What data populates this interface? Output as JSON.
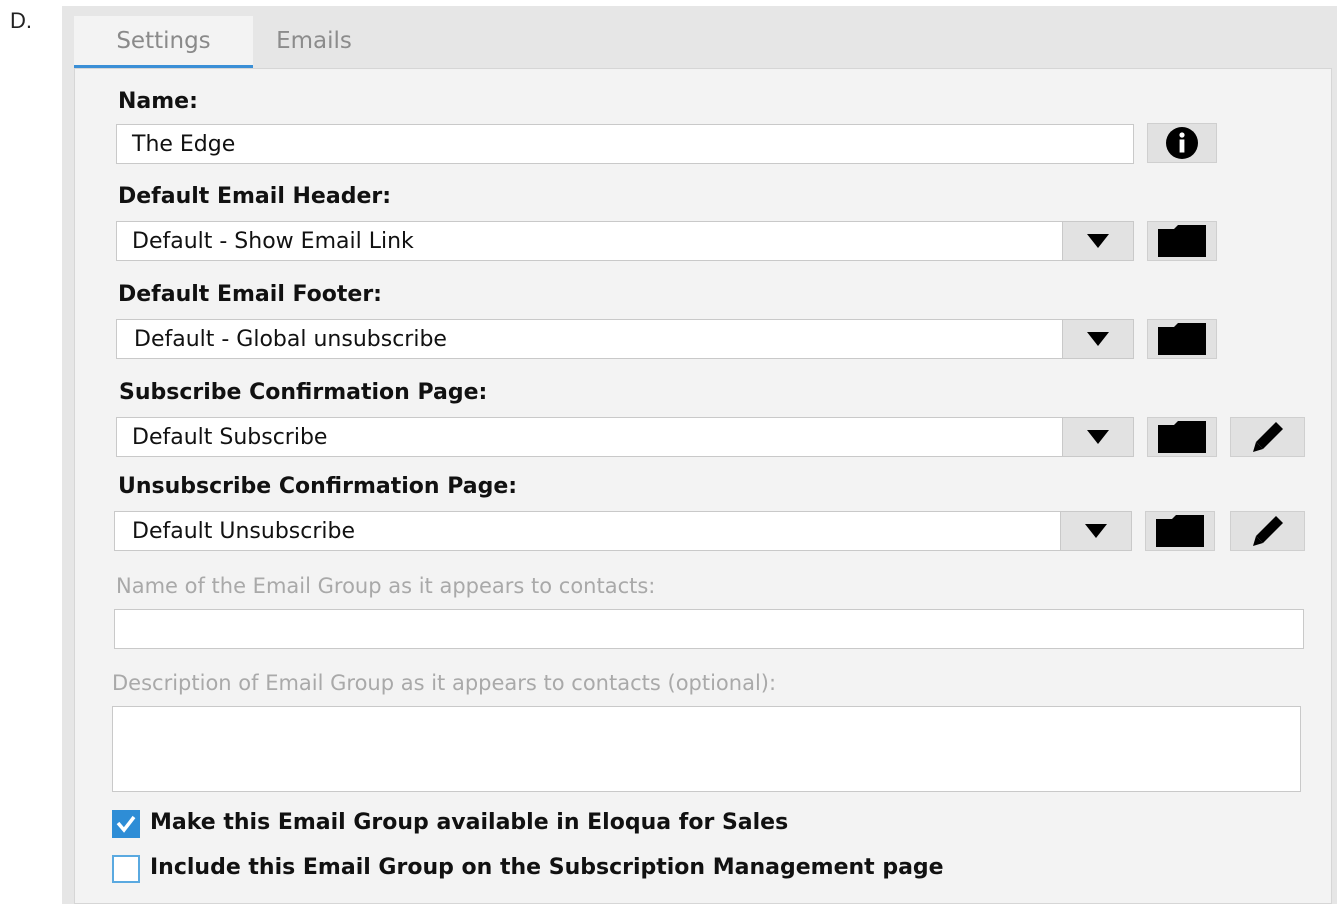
{
  "option_letter": "D.",
  "tabs": [
    {
      "label": "Settings",
      "active": true
    },
    {
      "label": "Emails",
      "active": false
    }
  ],
  "form": {
    "name_label": "Name:",
    "name_value": "The Edge",
    "header_label": "Default Email Header:",
    "header_value": "Default - Show Email Link",
    "footer_label": "Default Email Footer:",
    "footer_value": "Default - Global unsubscribe",
    "subscribe_label": "Subscribe Confirmation Page:",
    "subscribe_value": "Default Subscribe",
    "unsubscribe_label": "Unsubscribe Confirmation Page:",
    "unsubscribe_value": "Default Unsubscribe",
    "display_name_label": "Name of the Email Group as it appears to contacts:",
    "display_name_value": "",
    "description_label": "Description of Email Group as it appears to contacts (optional):",
    "description_value": "",
    "eloqua_sales_label": "Make this Email Group available in Eloqua for Sales",
    "eloqua_sales_checked": true,
    "subscription_mgmt_label": "Include this Email Group on the Subscription Management page",
    "subscription_mgmt_checked": false
  },
  "colors": {
    "accent": "#2e8dd6",
    "panel_bg": "#e6e6e6",
    "content_bg": "#f3f3f3"
  },
  "icons": [
    "info-icon",
    "dropdown-arrow-icon",
    "folder-icon",
    "pencil-icon",
    "checkmark-icon"
  ]
}
